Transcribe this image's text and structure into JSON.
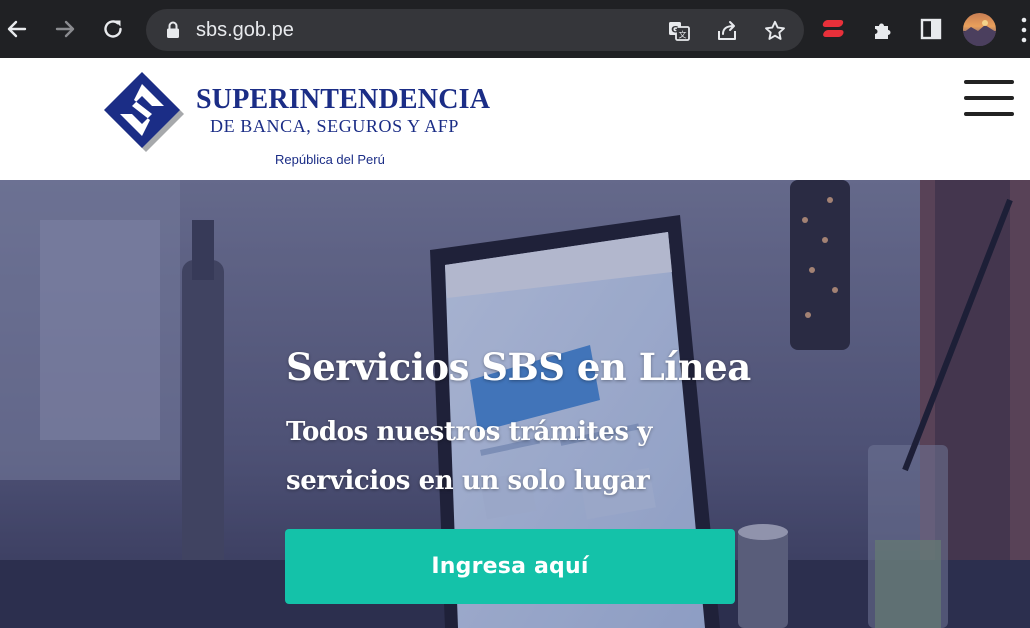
{
  "browser": {
    "url": "sbs.gob.pe",
    "icons": {
      "back": "arrow-left-icon",
      "forward": "arrow-right-icon",
      "reload": "reload-icon",
      "lock": "lock-icon",
      "translate": "translate-icon",
      "share": "share-icon",
      "bookmark": "star-icon",
      "extension": "red-extension-icon",
      "extensions": "puzzle-icon",
      "side_panel": "side-panel-icon",
      "profile": "avatar",
      "menu": "kebab-menu-icon"
    }
  },
  "header": {
    "logo_title": "SUPERINTENDENCIA",
    "logo_subtitle": "DE BANCA, SEGUROS Y AFP",
    "logo_country": "República del Perú",
    "menu_icon": "hamburger-icon",
    "brand_color": "#1b2d86"
  },
  "hero": {
    "title": "Servicios SBS en Línea",
    "subtitle": "Todos nuestros trámites y servicios en un solo lugar",
    "cta_label": "Ingresa aquí",
    "cta_color": "#14c2a9"
  }
}
